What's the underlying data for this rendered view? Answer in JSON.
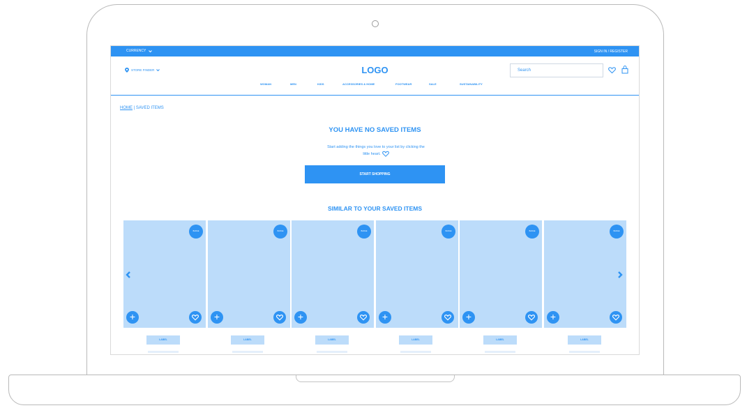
{
  "topbar": {
    "currency_label": "CURRENCY",
    "signin_label": "SIGN IN / REGISTER"
  },
  "header": {
    "store_finder_label": "STORE FINDER",
    "logo_text": "LOGO",
    "search_placeholder": "Search",
    "nav": [
      "WOMAN",
      "MEN",
      "KIDS",
      "ACCESSORIES & HOME",
      "FOOTWEAR",
      "SALE",
      "SUSTAINABILITY"
    ]
  },
  "breadcrumb": {
    "home": "HOME",
    "separator": "|",
    "current": "SAVED ITEMS"
  },
  "empty_state": {
    "title": "YOU HAVE NO SAVED ITEMS",
    "line1": "Start adding the things you love to your list by clicking the",
    "line2": "little heart.",
    "button_label": "START SHOPPING"
  },
  "similar": {
    "title": "SIMILAR TO YOUR SAVED ITEMS",
    "products": [
      {
        "badge": "BADGE",
        "label": "LABEL"
      },
      {
        "badge": "BADGE",
        "label": "LABEL"
      },
      {
        "badge": "BADGE",
        "label": "LABEL"
      },
      {
        "badge": "BADGE",
        "label": "LABEL"
      },
      {
        "badge": "BADGE",
        "label": "LABEL"
      },
      {
        "badge": "BADGE",
        "label": "LABEL"
      }
    ]
  },
  "colors": {
    "accent": "#2e93f3",
    "card_fill": "#bcdcfa"
  },
  "icons": [
    "chevron-down-icon",
    "location-pin-icon",
    "heart-icon",
    "bag-icon",
    "plus-icon",
    "chevron-left-icon",
    "chevron-right-icon"
  ]
}
